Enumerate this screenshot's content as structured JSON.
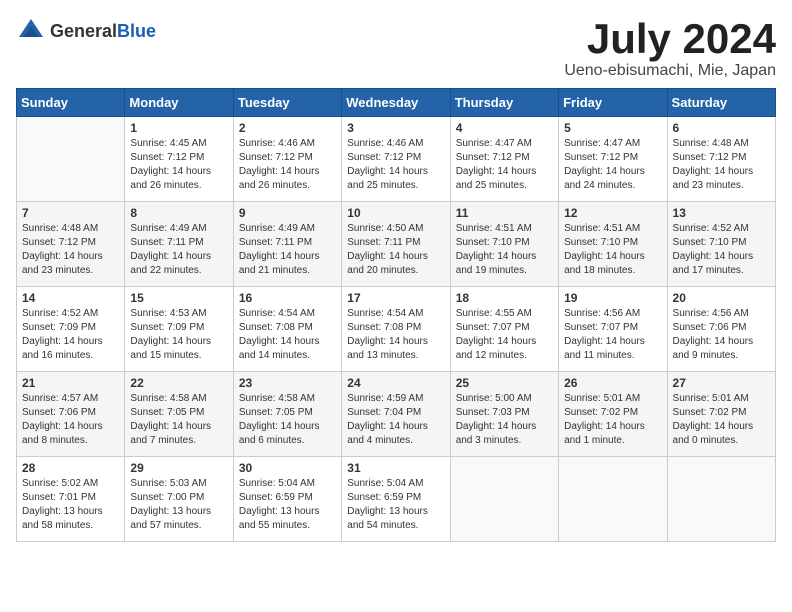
{
  "logo": {
    "general": "General",
    "blue": "Blue"
  },
  "title": "July 2024",
  "location": "Ueno-ebisumachi, Mie, Japan",
  "days_header": [
    "Sunday",
    "Monday",
    "Tuesday",
    "Wednesday",
    "Thursday",
    "Friday",
    "Saturday"
  ],
  "weeks": [
    [
      {
        "day": "",
        "detail": ""
      },
      {
        "day": "1",
        "detail": "Sunrise: 4:45 AM\nSunset: 7:12 PM\nDaylight: 14 hours\nand 26 minutes."
      },
      {
        "day": "2",
        "detail": "Sunrise: 4:46 AM\nSunset: 7:12 PM\nDaylight: 14 hours\nand 26 minutes."
      },
      {
        "day": "3",
        "detail": "Sunrise: 4:46 AM\nSunset: 7:12 PM\nDaylight: 14 hours\nand 25 minutes."
      },
      {
        "day": "4",
        "detail": "Sunrise: 4:47 AM\nSunset: 7:12 PM\nDaylight: 14 hours\nand 25 minutes."
      },
      {
        "day": "5",
        "detail": "Sunrise: 4:47 AM\nSunset: 7:12 PM\nDaylight: 14 hours\nand 24 minutes."
      },
      {
        "day": "6",
        "detail": "Sunrise: 4:48 AM\nSunset: 7:12 PM\nDaylight: 14 hours\nand 23 minutes."
      }
    ],
    [
      {
        "day": "7",
        "detail": "Sunrise: 4:48 AM\nSunset: 7:12 PM\nDaylight: 14 hours\nand 23 minutes."
      },
      {
        "day": "8",
        "detail": "Sunrise: 4:49 AM\nSunset: 7:11 PM\nDaylight: 14 hours\nand 22 minutes."
      },
      {
        "day": "9",
        "detail": "Sunrise: 4:49 AM\nSunset: 7:11 PM\nDaylight: 14 hours\nand 21 minutes."
      },
      {
        "day": "10",
        "detail": "Sunrise: 4:50 AM\nSunset: 7:11 PM\nDaylight: 14 hours\nand 20 minutes."
      },
      {
        "day": "11",
        "detail": "Sunrise: 4:51 AM\nSunset: 7:10 PM\nDaylight: 14 hours\nand 19 minutes."
      },
      {
        "day": "12",
        "detail": "Sunrise: 4:51 AM\nSunset: 7:10 PM\nDaylight: 14 hours\nand 18 minutes."
      },
      {
        "day": "13",
        "detail": "Sunrise: 4:52 AM\nSunset: 7:10 PM\nDaylight: 14 hours\nand 17 minutes."
      }
    ],
    [
      {
        "day": "14",
        "detail": "Sunrise: 4:52 AM\nSunset: 7:09 PM\nDaylight: 14 hours\nand 16 minutes."
      },
      {
        "day": "15",
        "detail": "Sunrise: 4:53 AM\nSunset: 7:09 PM\nDaylight: 14 hours\nand 15 minutes."
      },
      {
        "day": "16",
        "detail": "Sunrise: 4:54 AM\nSunset: 7:08 PM\nDaylight: 14 hours\nand 14 minutes."
      },
      {
        "day": "17",
        "detail": "Sunrise: 4:54 AM\nSunset: 7:08 PM\nDaylight: 14 hours\nand 13 minutes."
      },
      {
        "day": "18",
        "detail": "Sunrise: 4:55 AM\nSunset: 7:07 PM\nDaylight: 14 hours\nand 12 minutes."
      },
      {
        "day": "19",
        "detail": "Sunrise: 4:56 AM\nSunset: 7:07 PM\nDaylight: 14 hours\nand 11 minutes."
      },
      {
        "day": "20",
        "detail": "Sunrise: 4:56 AM\nSunset: 7:06 PM\nDaylight: 14 hours\nand 9 minutes."
      }
    ],
    [
      {
        "day": "21",
        "detail": "Sunrise: 4:57 AM\nSunset: 7:06 PM\nDaylight: 14 hours\nand 8 minutes."
      },
      {
        "day": "22",
        "detail": "Sunrise: 4:58 AM\nSunset: 7:05 PM\nDaylight: 14 hours\nand 7 minutes."
      },
      {
        "day": "23",
        "detail": "Sunrise: 4:58 AM\nSunset: 7:05 PM\nDaylight: 14 hours\nand 6 minutes."
      },
      {
        "day": "24",
        "detail": "Sunrise: 4:59 AM\nSunset: 7:04 PM\nDaylight: 14 hours\nand 4 minutes."
      },
      {
        "day": "25",
        "detail": "Sunrise: 5:00 AM\nSunset: 7:03 PM\nDaylight: 14 hours\nand 3 minutes."
      },
      {
        "day": "26",
        "detail": "Sunrise: 5:01 AM\nSunset: 7:02 PM\nDaylight: 14 hours\nand 1 minute."
      },
      {
        "day": "27",
        "detail": "Sunrise: 5:01 AM\nSunset: 7:02 PM\nDaylight: 14 hours\nand 0 minutes."
      }
    ],
    [
      {
        "day": "28",
        "detail": "Sunrise: 5:02 AM\nSunset: 7:01 PM\nDaylight: 13 hours\nand 58 minutes."
      },
      {
        "day": "29",
        "detail": "Sunrise: 5:03 AM\nSunset: 7:00 PM\nDaylight: 13 hours\nand 57 minutes."
      },
      {
        "day": "30",
        "detail": "Sunrise: 5:04 AM\nSunset: 6:59 PM\nDaylight: 13 hours\nand 55 minutes."
      },
      {
        "day": "31",
        "detail": "Sunrise: 5:04 AM\nSunset: 6:59 PM\nDaylight: 13 hours\nand 54 minutes."
      },
      {
        "day": "",
        "detail": ""
      },
      {
        "day": "",
        "detail": ""
      },
      {
        "day": "",
        "detail": ""
      }
    ]
  ]
}
